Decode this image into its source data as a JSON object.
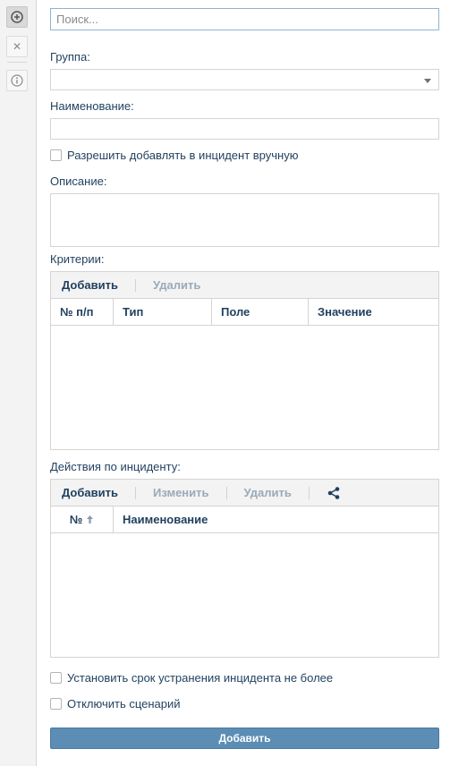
{
  "search": {
    "placeholder": "Поиск..."
  },
  "form": {
    "group_label": "Группа:",
    "group_value": "",
    "name_label": "Наименование:",
    "name_value": "",
    "allow_manual_label": "Разрешить добавлять в инцидент вручную",
    "description_label": "Описание:",
    "criteria_label": "Критерии:",
    "actions_label": "Действия по инциденту:",
    "deadline_label": "Установить срок устранения инцидента не более",
    "disable_scenario_label": "Отключить сценарий",
    "submit_label": "Добавить"
  },
  "criteria_grid": {
    "toolbar": {
      "add": "Добавить",
      "delete": "Удалить"
    },
    "columns": [
      "№ п/п",
      "Тип",
      "Поле",
      "Значение"
    ],
    "rows": []
  },
  "actions_grid": {
    "toolbar": {
      "add": "Добавить",
      "edit": "Изменить",
      "delete": "Удалить"
    },
    "columns": [
      "№",
      "Наименование"
    ],
    "rows": []
  },
  "icons": {
    "add": "plus-circle-icon",
    "close": "close-icon",
    "info": "info-icon",
    "share": "share-icon",
    "sort_asc": "arrow-up-icon"
  }
}
